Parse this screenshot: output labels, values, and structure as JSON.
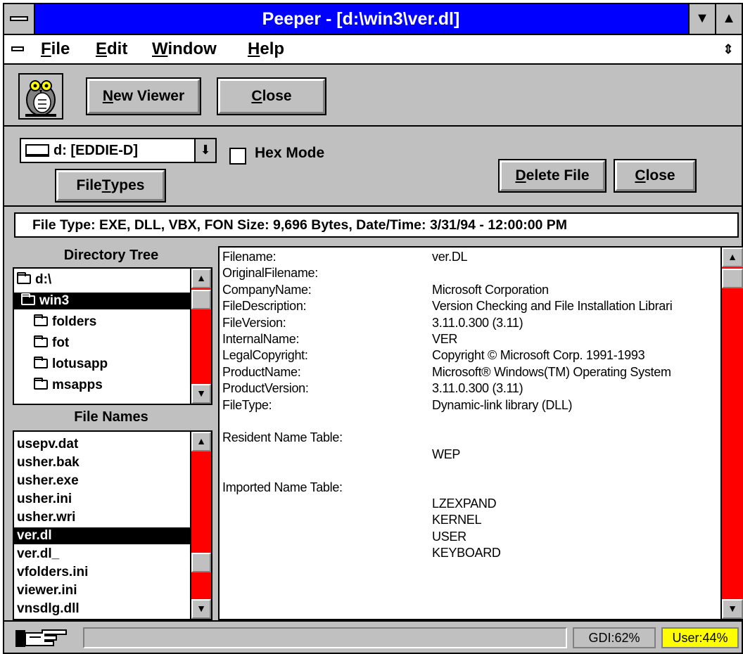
{
  "window": {
    "title": "Peeper - [d:\\win3\\ver.dl]",
    "minimize_glyph": "▼",
    "maximize_glyph": "▲",
    "restore_glyph": "⇕"
  },
  "menu": {
    "items": [
      {
        "accel": "F",
        "rest": "ile"
      },
      {
        "accel": "E",
        "rest": "dit"
      },
      {
        "accel": "W",
        "rest": "indow"
      },
      {
        "accel": "H",
        "rest": "elp"
      }
    ]
  },
  "toolbar": {
    "logo_icon": "owl-icon",
    "new_viewer": {
      "accel": "N",
      "rest": "ew Viewer"
    },
    "close": {
      "accel": "C",
      "rest": "lose"
    }
  },
  "controls": {
    "drive": "d: [EDDIE-D]",
    "hex_mode": "Hex Mode",
    "hex_checked": false,
    "file_types": {
      "pre": "File ",
      "accel": "T",
      "rest": "ypes"
    },
    "delete_file": {
      "accel": "D",
      "rest": "elete File"
    },
    "close": {
      "accel": "C",
      "rest": "lose"
    }
  },
  "info_line": "File Type: EXE, DLL, VBX, FON   Size: 9,696 Bytes, Date/Time: 3/31/94 - 12:00:00 PM",
  "directory_tree": {
    "heading": "Directory Tree",
    "items": [
      {
        "label": "d:\\",
        "selected": false
      },
      {
        "label": "win3",
        "selected": true
      },
      {
        "label": "folders",
        "selected": false
      },
      {
        "label": "fot",
        "selected": false
      },
      {
        "label": "lotusapp",
        "selected": false
      },
      {
        "label": "msapps",
        "selected": false
      }
    ]
  },
  "file_names": {
    "heading": "File Names",
    "items": [
      {
        "label": "usepv.dat",
        "selected": false
      },
      {
        "label": "usher.bak",
        "selected": false
      },
      {
        "label": "usher.exe",
        "selected": false
      },
      {
        "label": "usher.ini",
        "selected": false
      },
      {
        "label": "usher.wri",
        "selected": false
      },
      {
        "label": "ver.dl",
        "selected": true
      },
      {
        "label": "ver.dl_",
        "selected": false
      },
      {
        "label": "vfolders.ini",
        "selected": false
      },
      {
        "label": "viewer.ini",
        "selected": false
      },
      {
        "label": "vnsdlg.dll",
        "selected": false
      }
    ]
  },
  "viewer": {
    "lines": [
      {
        "key": "Filename:",
        "value": "ver.DL"
      },
      {
        "key": "OriginalFilename:",
        "value": ""
      },
      {
        "key": "CompanyName:",
        "value": "Microsoft Corporation"
      },
      {
        "key": "FileDescription:",
        "value": "Version Checking and File Installation Librari"
      },
      {
        "key": "FileVersion:",
        "value": "3.11.0.300 (3.11)"
      },
      {
        "key": "InternalName:",
        "value": "VER"
      },
      {
        "key": "LegalCopyright:",
        "value": "Copyright © Microsoft Corp. 1991-1993"
      },
      {
        "key": "ProductName:",
        "value": "Microsoft® Windows(TM) Operating System"
      },
      {
        "key": "ProductVersion:",
        "value": "3.11.0.300 (3.11)"
      },
      {
        "key": "FileType:",
        "value": "Dynamic-link library (DLL)"
      },
      {
        "key": "",
        "value": ""
      },
      {
        "key": "Resident Name Table:",
        "value": ""
      },
      {
        "key": "",
        "value": "WEP"
      },
      {
        "key": "",
        "value": ""
      },
      {
        "key": "Imported Name Table:",
        "value": ""
      },
      {
        "key": "",
        "value": "LZEXPAND"
      },
      {
        "key": "",
        "value": "KERNEL"
      },
      {
        "key": "",
        "value": "USER"
      },
      {
        "key": "",
        "value": "KEYBOARD"
      }
    ]
  },
  "status": {
    "hand_icon": "pointing-hand-icon",
    "message": "",
    "gdi": "GDI:62%",
    "user": "User:44%",
    "user_color": "#ffff00"
  },
  "colors": {
    "title_bar": "#0000ff",
    "scrollbar_track": "#ff0000",
    "face": "#c0c0c0"
  },
  "scroll_glyphs": {
    "up": "▲",
    "down": "▼"
  }
}
